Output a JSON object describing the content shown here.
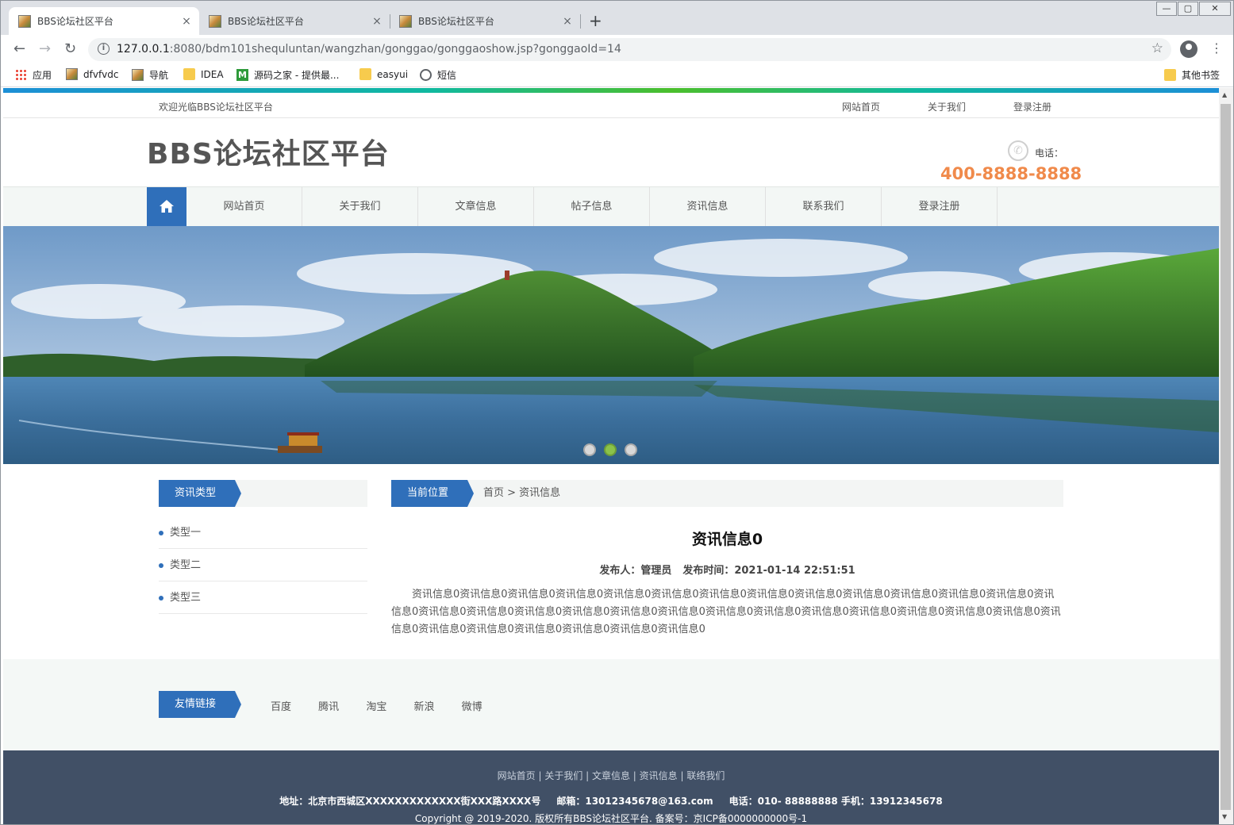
{
  "browser": {
    "tabs": [
      {
        "title": "BBS论坛社区平台",
        "close": "×"
      },
      {
        "title": "BBS论坛社区平台",
        "close": "×"
      },
      {
        "title": "BBS论坛社区平台",
        "close": "×"
      }
    ],
    "new_tab": "+",
    "window_controls": {
      "minimize": "—",
      "restore": "▢",
      "close": "✕"
    },
    "url_host": "127.0.0.1",
    "url_rest": ":8080/bdm101shequluntan/wangzhan/gonggao/gonggaoshow.jsp?gonggaoId=14",
    "bookmarks": [
      {
        "label": "应用",
        "icon": "apps-grid-icon"
      },
      {
        "label": "dfvfvdc",
        "icon": "image-icon"
      },
      {
        "label": "导航",
        "icon": "image-icon"
      },
      {
        "label": "IDEA",
        "icon": "folder-icon"
      },
      {
        "label": "源码之家 - 提供最...",
        "icon": "m-icon"
      },
      {
        "label": "easyui",
        "icon": "folder-icon"
      },
      {
        "label": "短信",
        "icon": "globe-icon"
      }
    ],
    "other_bookmarks": "其他书签"
  },
  "site": {
    "welcome": "欢迎光临BBS论坛社区平台",
    "top_links": [
      "网站首页",
      "关于我们",
      "登录注册"
    ],
    "logo": "BBS论坛社区平台",
    "phone_label": "电话：",
    "phone_number": "400-8888-8888",
    "nav": [
      "网站首页",
      "关于我们",
      "文章信息",
      "帖子信息",
      "资讯信息",
      "联系我们",
      "登录注册"
    ],
    "banner_dots": 3,
    "banner_active_dot": 2
  },
  "sidebar": {
    "title": "资讯类型",
    "items": [
      "类型一",
      "类型二",
      "类型三"
    ]
  },
  "breadcrumb": {
    "label": "当前位置",
    "path": "首页 > 资讯信息"
  },
  "article": {
    "title": "资讯信息0",
    "author": "发布人：管理员",
    "time": "发布时间：2021-01-14 22:51:51",
    "body": "资讯信息0资讯信息0资讯信息0资讯信息0资讯信息0资讯信息0资讯信息0资讯信息0资讯信息0资讯信息0资讯信息0资讯信息0资讯信息0资讯信息0资讯信息0资讯信息0资讯信息0资讯信息0资讯信息0资讯信息0资讯信息0资讯信息0资讯信息0资讯信息0资讯信息0资讯信息0资讯信息0资讯信息0资讯信息0资讯信息0资讯信息0资讯信息0资讯信息0资讯信息0"
  },
  "friends": {
    "title": "友情链接",
    "links": [
      "百度",
      "腾讯",
      "淘宝",
      "新浪",
      "微博"
    ]
  },
  "footer": {
    "nav": "网站首页 | 关于我们 | 文章信息 | 资讯信息 | 联络我们",
    "address": "地址：北京市西城区XXXXXXXXXXXXX街XXX路XXXX号",
    "email": "邮箱：13012345678@163.com",
    "phone": "电话：010- 88888888 手机：13912345678",
    "copyright": "Copyright @ 2019-2020. 版权所有BBS论坛社区平台. 备案号：京ICP备0000000000号-1"
  }
}
